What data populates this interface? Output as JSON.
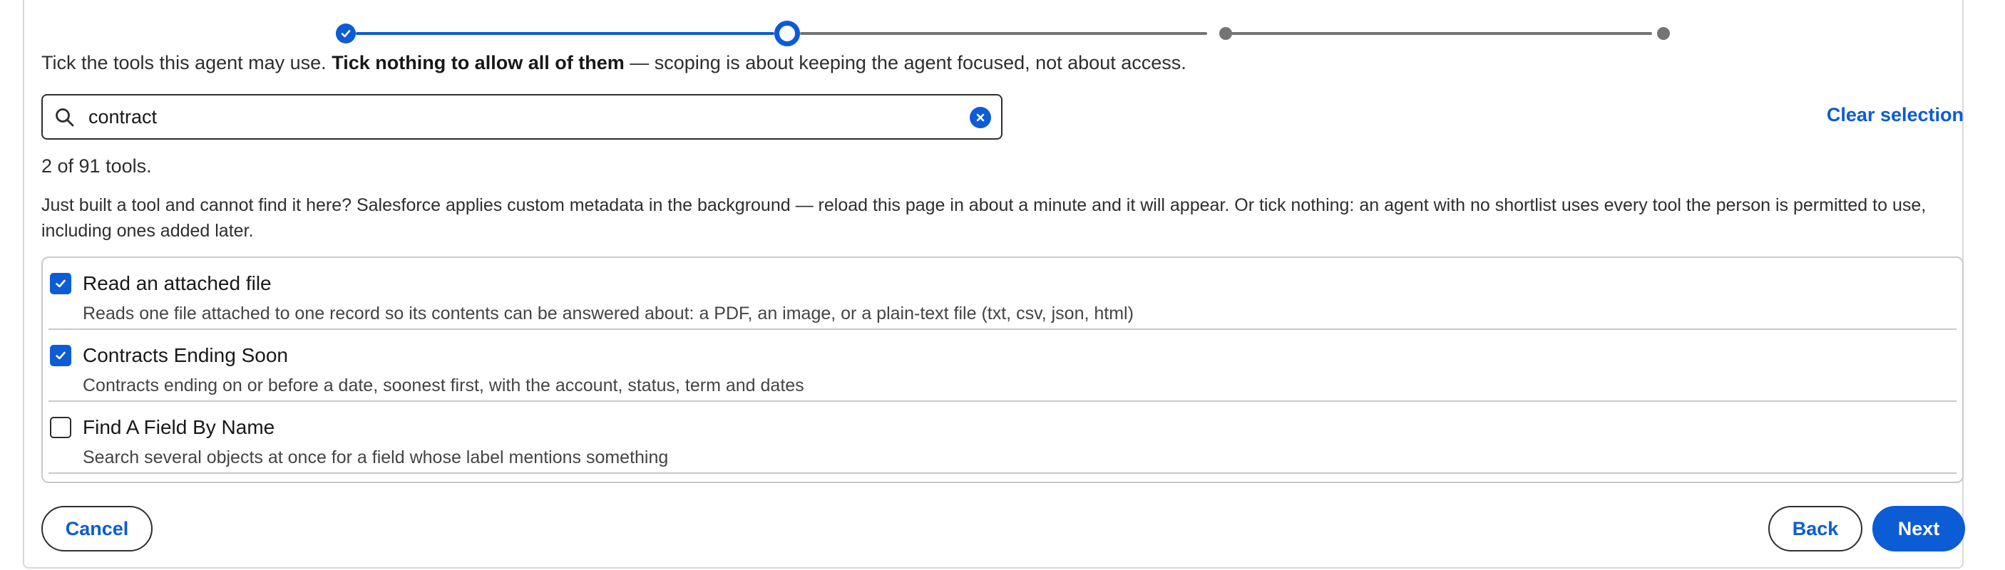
{
  "intro": {
    "lead": "Tick the tools this agent may use. ",
    "emphasis": "Tick nothing to allow all of them",
    "tail": " — scoping is about keeping the agent focused, not about access."
  },
  "search": {
    "value": "contract",
    "placeholder": "",
    "icon": "search-icon",
    "clear_icon": "clear-circle-icon"
  },
  "clear_selection_label": "Clear selection",
  "count_text": "2 of 91 tools.",
  "hint_text": "Just built a tool and cannot find it here? Salesforce applies custom metadata in the background — reload this page in about a minute and it will appear. Or tick nothing: an agent with no shortlist uses every tool the person is permitted to use, including ones added later.",
  "tools": [
    {
      "title": "Read an attached file",
      "description": "Reads one file attached to one record so its contents can be answered about: a PDF, an image, or a plain-text file (txt, csv, json, html)",
      "checked": true
    },
    {
      "title": "Contracts Ending Soon",
      "description": "Contracts ending on or before a date, soonest first, with the account, status, term and dates",
      "checked": true
    },
    {
      "title": "Find A Field By Name",
      "description": "Search several objects at once for a field whose label mentions something",
      "checked": false
    }
  ],
  "buttons": {
    "cancel": "Cancel",
    "back": "Back",
    "next": "Next"
  },
  "stepper": {
    "total_steps": 4,
    "current_step": 2,
    "completed_steps": 1
  },
  "colors": {
    "brand": "#0b5cd5",
    "pending": "#747474",
    "border": "#c9c9c9"
  }
}
